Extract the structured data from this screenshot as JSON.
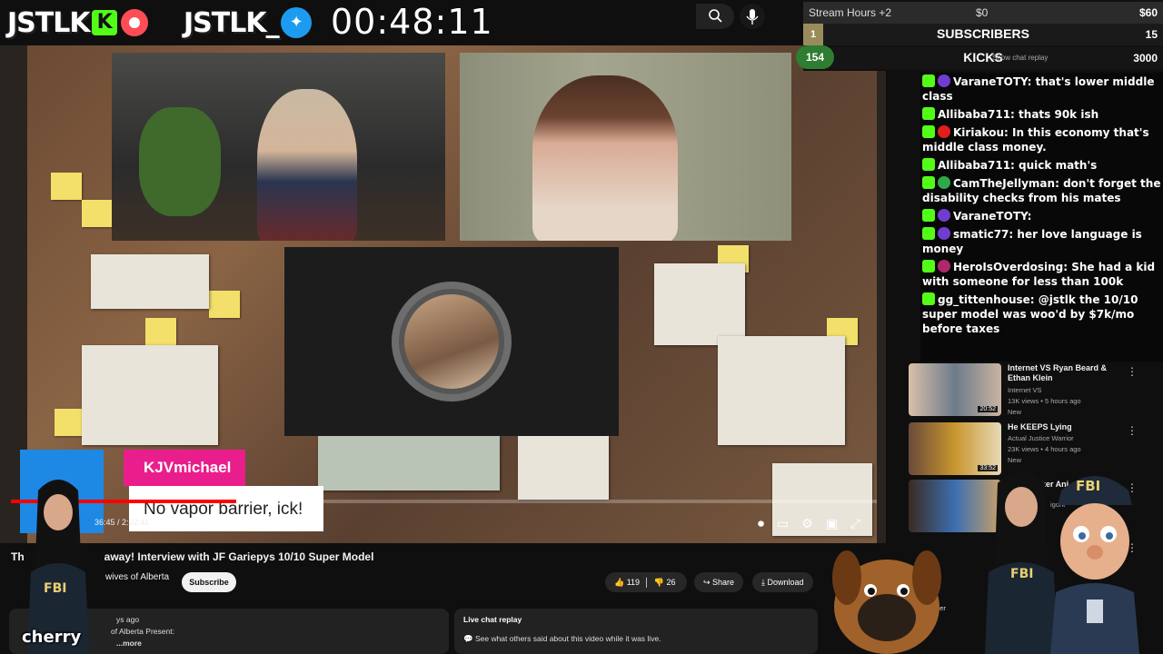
{
  "header": {
    "logo_text_1": "JSTLK",
    "logo_badge_1": "K",
    "logo_text_2": "JSTLK_",
    "timer": "00:48:11"
  },
  "stats": {
    "row1": {
      "label": "Stream Hours +2",
      "mid": "$0",
      "right": "$60"
    },
    "row2": {
      "badge": "1",
      "title": "SUBSCRIBERS",
      "right": "15"
    },
    "row3": {
      "badge": "154",
      "title": "KICKS",
      "right": "3000"
    },
    "replay_hint": "Show chat replay"
  },
  "chat": [
    {
      "user": "VaraneTOTY:",
      "text": "that's lower middle class",
      "color": "#6f3dd1"
    },
    {
      "user": "Allibaba711:",
      "text": "thats 90k ish",
      "color": ""
    },
    {
      "user": "Kiriakou:",
      "text": "In this economy that's middle class money.",
      "color": "#e01e1e"
    },
    {
      "user": "Allibaba711:",
      "text": "quick math's",
      "color": ""
    },
    {
      "user": "CamTheJellyman:",
      "text": "don't forget the disability checks from his mates",
      "color": "#2ea84a"
    },
    {
      "user": "VaraneTOTY:",
      "text": "",
      "color": "#6f3dd1"
    },
    {
      "user": "smatic77:",
      "text": "her love language is money",
      "color": "#6f3dd1"
    },
    {
      "user": "HeroIsOverdosing:",
      "text": "She had a kid with someone for less than 100k",
      "color": "#b0276a"
    },
    {
      "user": "gg_tittenhouse:",
      "text": "@jstlk the 10/10 super model was woo'd by $7k/mo before taxes",
      "color": ""
    }
  ],
  "video": {
    "popup_name": "KJVmichael",
    "popup_message": "No vapor barrier, ick!",
    "time_label": "36:45 / 2:22:41",
    "progress": 0.26
  },
  "below": {
    "title_left": "Th",
    "title_right": "away! Interview with JF Gariepys 10/10 Super Model",
    "channel": "wives of Alberta",
    "subscribe": "Subscribe",
    "likes": "119",
    "dislikes": "26",
    "share": "Share",
    "download": "Download",
    "desc_line1": "ys ago",
    "desc_line2": "of Alberta Present:",
    "desc_more": "...more",
    "replay_head": "Live chat replay",
    "replay_text": "See what others said about this video while it was live."
  },
  "related": [
    {
      "title": "Internet VS Ryan Beard & Ethan Klein",
      "channel": "Internet VS",
      "meta": "13K views • 5 hours ago",
      "badge": "New",
      "duration": "20:52"
    },
    {
      "title": "He KEEPS Lying",
      "channel": "Actual Justice Warrior",
      "meta": "23K views • 4 hours ago",
      "badge": "New",
      "duration": "33:52"
    },
    {
      "title": "ker Ani",
      "channel": "Rasan Piker",
      "meta": "igorit",
      "badge": "",
      "duration": ""
    }
  ],
  "overlay": {
    "cherry": "cherry",
    "fbi_label": "FBI"
  }
}
